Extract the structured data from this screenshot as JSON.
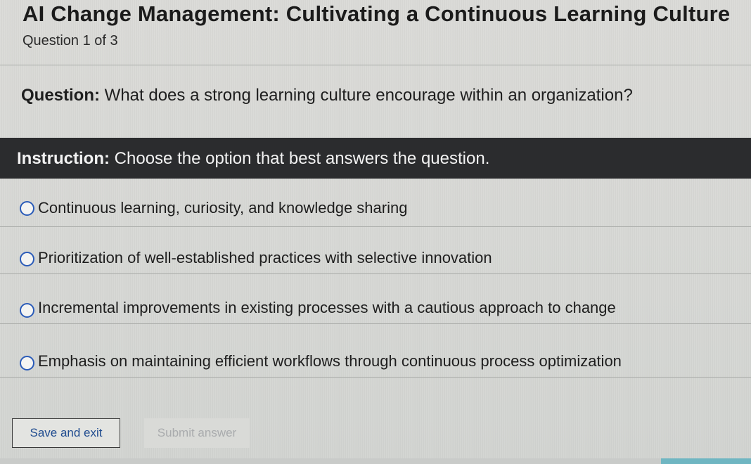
{
  "header": {
    "title": "AI Change Management: Cultivating a Continuous Learning Culture",
    "counter": "Question 1 of 3"
  },
  "question": {
    "label": "Question:",
    "text": "What does a strong learning culture encourage within an organization?"
  },
  "instruction": {
    "label": "Instruction:",
    "text": "Choose the option that best answers the question."
  },
  "options": [
    {
      "label": "Continuous learning, curiosity, and knowledge sharing",
      "selected": false
    },
    {
      "label": "Prioritization of well-established practices with selective innovation",
      "selected": false
    },
    {
      "label": "Incremental improvements in existing processes with a cautious approach to change",
      "selected": false
    },
    {
      "label": "Emphasis on maintaining efficient workflows through continuous process optimization",
      "selected": false
    }
  ],
  "actions": {
    "save_label": "Save and exit",
    "submit_label": "Submit answer",
    "submit_enabled": false
  },
  "colors": {
    "instruction_bar": "#2b2c2e",
    "radio_border": "#2a5bb8",
    "save_text": "#1f4b8f",
    "submit_disabled_text": "#a9abad"
  }
}
